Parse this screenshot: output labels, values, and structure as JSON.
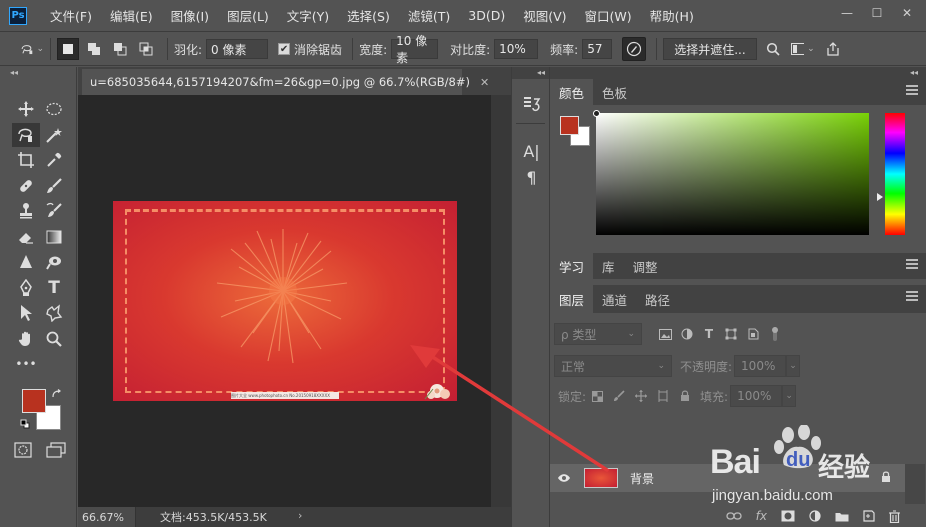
{
  "app": {
    "logo": "Ps"
  },
  "menu": [
    "文件(F)",
    "编辑(E)",
    "图像(I)",
    "图层(L)",
    "文字(Y)",
    "选择(S)",
    "滤镜(T)",
    "3D(D)",
    "视图(V)",
    "窗口(W)",
    "帮助(H)"
  ],
  "window_controls": {
    "minimize": "—",
    "maximize": "☐",
    "close": "✕"
  },
  "options": {
    "feather_label": "羽化:",
    "feather_value": "0 像素",
    "antialias_label": "消除锯齿",
    "antialias_checked": true,
    "width_label": "宽度:",
    "width_value": "10 像素",
    "contrast_label": "对比度:",
    "contrast_value": "10%",
    "frequency_label": "频率:",
    "frequency_value": "57",
    "select_mask_label": "选择并遮住..."
  },
  "toolbar": {
    "collapse": "◂◂",
    "tools": [
      [
        "move-icon",
        "marquee-icon"
      ],
      [
        "magnetic-lasso-icon",
        "magic-wand-icon"
      ],
      [
        "crop-icon",
        "eyedropper-icon"
      ],
      [
        "healing-brush-icon",
        "brush-icon"
      ],
      [
        "clone-stamp-icon",
        "history-brush-icon"
      ],
      [
        "eraser-icon",
        "gradient-icon"
      ],
      [
        "blur-icon",
        "dodge-icon"
      ],
      [
        "pen-icon",
        "type-icon"
      ],
      [
        "path-selection-icon",
        "custom-shape-icon"
      ],
      [
        "hand-icon",
        "zoom-icon"
      ],
      [
        "more-tools-icon"
      ]
    ],
    "more_label": "•••",
    "type_glyph": "T",
    "foreground_color": "#b8321f",
    "background_color": "#ffffff"
  },
  "document": {
    "tab_title": "u=685035644,6157194207&fm=26&gp=0.jpg @ 66.7%(RGB/8#)",
    "close": "✕",
    "image_watermark_text": "图片大全 www.photophoto.cn No.20150918XXXXX"
  },
  "status": {
    "zoom": "66.67%",
    "doc_size": "文档:453.5K/453.5K",
    "arrow": "›"
  },
  "midstrip": {
    "collapse": "◂◂",
    "text_icon": "A|",
    "para_icon": "¶"
  },
  "right": {
    "collapse": "◂◂",
    "color_tabs": [
      {
        "label": "颜色",
        "active": true
      },
      {
        "label": "色板",
        "active": false
      }
    ],
    "learn_tabs": [
      {
        "label": "学习",
        "active": true
      },
      {
        "label": "库",
        "active": false
      },
      {
        "label": "调整",
        "active": false
      }
    ],
    "layer_tabs": [
      {
        "label": "图层",
        "active": true
      },
      {
        "label": "通道",
        "active": false
      },
      {
        "label": "路径",
        "active": false
      }
    ],
    "filter_placeholder": "ρ 类型",
    "blend_mode": "正常",
    "opacity_label": "不透明度:",
    "opacity_value": "100%",
    "lock_label": "锁定:",
    "fill_label": "填充:",
    "fill_value": "100%",
    "layer_name": "背景",
    "footer_icons": [
      "link-icon",
      "fx-icon",
      "mask-icon",
      "adjustment-icon",
      "group-icon",
      "new-layer-icon",
      "trash-icon"
    ],
    "footer_fx": "fx"
  },
  "watermark": {
    "brand": "Bai",
    "brand_mid": "du",
    "brand_cn": "经验",
    "url": "jingyan.baidu.com"
  },
  "colors": {
    "accent_red": "#e03a3a",
    "ps_blue": "#31a8ff"
  }
}
